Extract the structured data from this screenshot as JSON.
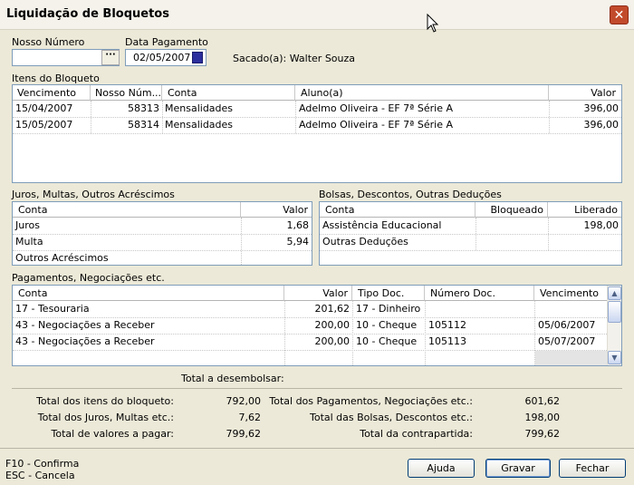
{
  "window": {
    "title": "Liquidação de Bloquetos",
    "close_label": "✕"
  },
  "fields": {
    "nosso_numero_label": "Nosso Número",
    "nosso_numero_value": "",
    "ellipsis": "···",
    "data_pagamento_label": "Data Pagamento",
    "data_pagamento_value": "02/05/2007",
    "sacado": "Sacado(a): Walter Souza"
  },
  "itens": {
    "title": "Itens do Bloqueto",
    "headers": [
      "Vencimento",
      "Nosso Núm...",
      "Conta",
      "Aluno(a)",
      "Valor"
    ],
    "rows": [
      [
        "15/04/2007",
        "58313",
        "Mensalidades",
        "Adelmo Oliveira - EF 7ª Série A",
        "396,00"
      ],
      [
        "15/05/2007",
        "58314",
        "Mensalidades",
        "Adelmo Oliveira - EF 7ª Série A",
        "396,00"
      ]
    ]
  },
  "juros": {
    "title": "Juros, Multas, Outros Acréscimos",
    "headers": [
      "Conta",
      "Valor"
    ],
    "rows": [
      [
        "Juros",
        "1,68"
      ],
      [
        "Multa",
        "5,94"
      ],
      [
        "Outros Acréscimos",
        ""
      ]
    ]
  },
  "bolsas": {
    "title": "Bolsas, Descontos, Outras Deduções",
    "headers": [
      "Conta",
      "Bloqueado",
      "Liberado"
    ],
    "rows": [
      [
        "Assistência Educacional",
        "",
        "198,00"
      ],
      [
        "Outras Deduções",
        "",
        ""
      ]
    ]
  },
  "pagamentos": {
    "title": "Pagamentos, Negociações etc.",
    "headers": [
      "Conta",
      "Valor",
      "Tipo Doc.",
      "Número Doc.",
      "Vencimento"
    ],
    "rows": [
      [
        "17 - Tesouraria",
        "201,62",
        "17 - Dinheiro",
        "",
        ""
      ],
      [
        "43 - Negociações a Receber",
        "200,00",
        "10 - Cheque",
        "105112",
        "05/06/2007"
      ],
      [
        "43 - Negociações a Receber",
        "200,00",
        "10 - Cheque",
        "105113",
        "05/07/2007"
      ]
    ]
  },
  "totais": {
    "header": "Total a desembolsar:",
    "left": [
      {
        "label": "Total dos itens do bloqueto:",
        "value": "792,00"
      },
      {
        "label": "Total dos Juros, Multas etc.:",
        "value": "7,62"
      },
      {
        "label": "Total de valores a pagar:",
        "value": "799,62"
      }
    ],
    "right": [
      {
        "label": "Total dos Pagamentos, Negociações etc.:",
        "value": "601,62"
      },
      {
        "label": "Total das Bolsas, Descontos etc.:",
        "value": "198,00"
      },
      {
        "label": "Total da contrapartida:",
        "value": "799,62"
      }
    ]
  },
  "footer": {
    "hint1": "F10 - Confirma",
    "hint2": "ESC - Cancela",
    "ajuda": "Ajuda",
    "gravar": "Gravar",
    "fechar": "Fechar"
  }
}
